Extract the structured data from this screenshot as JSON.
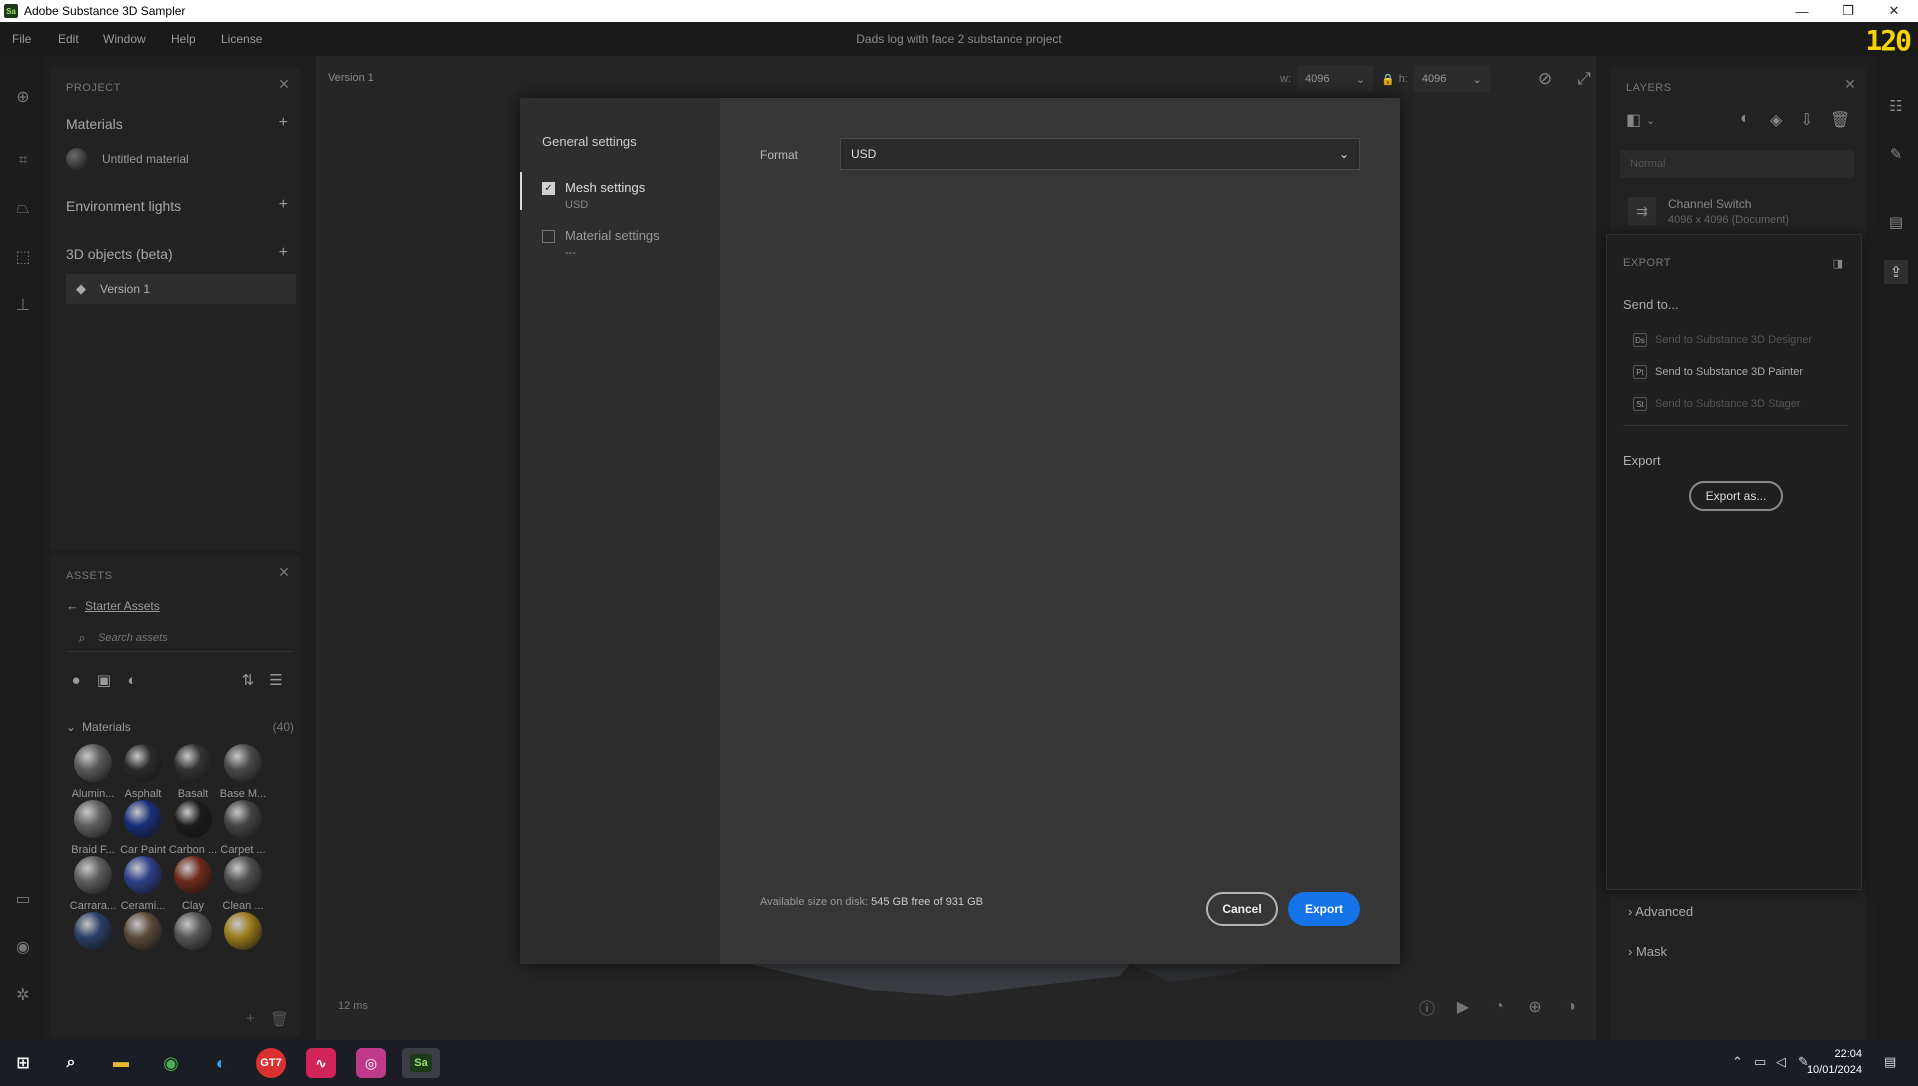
{
  "window": {
    "app_name": "Adobe Substance 3D Sampler",
    "logo": "Sa",
    "minimize": "—",
    "maximize": "❐",
    "close": "✕"
  },
  "menu": [
    "File",
    "Edit",
    "Window",
    "Help",
    "License"
  ],
  "document_title": "Dads log with face 2 substance project",
  "fps_overlay": "120",
  "project": {
    "header": "PROJECT",
    "materials_title": "Materials",
    "material_item": "Untitled material",
    "env_title": "Environment lights",
    "objects_title": "3D objects (beta)",
    "object_item": "Version 1"
  },
  "assets": {
    "header": "ASSETS",
    "breadcrumb": "Starter Assets",
    "search_placeholder": "Search assets",
    "materials_label": "Materials",
    "materials_count": "(40)",
    "swatches": [
      {
        "label": "Alumin...",
        "color": "#5a5a5a"
      },
      {
        "label": "Asphalt",
        "color": "#2b2b2b"
      },
      {
        "label": "Basalt",
        "color": "#333333"
      },
      {
        "label": "Base M...",
        "color": "#4a4a4a"
      },
      {
        "label": "Braid F...",
        "color": "#606060"
      },
      {
        "label": "Car Paint",
        "color": "#1a2f7a"
      },
      {
        "label": "Carbon ...",
        "color": "#1c1c1c"
      },
      {
        "label": "Carpet ...",
        "color": "#454545"
      },
      {
        "label": "Carrara...",
        "color": "#5c5c5c"
      },
      {
        "label": "Cerami...",
        "color": "#2e3f8a"
      },
      {
        "label": "Clay",
        "color": "#6e2a1a"
      },
      {
        "label": "Clean ...",
        "color": "#4e4e4e"
      },
      {
        "label": "",
        "color": "#2a3f66"
      },
      {
        "label": "",
        "color": "#5a4a3a"
      },
      {
        "label": "",
        "color": "#555555"
      },
      {
        "label": "",
        "color": "#9a7a1a"
      }
    ]
  },
  "viewport": {
    "title": "Version 1",
    "w_label": "w:",
    "w_value": "4096",
    "h_label": "h:",
    "h_value": "4096",
    "render_time": "12 ms"
  },
  "layers": {
    "header": "LAYERS",
    "blend_mode": "Normal",
    "layer_name": "Channel Switch",
    "layer_sub": "4096 x 4096 (Document)",
    "advanced": "Advanced",
    "mask": "Mask"
  },
  "export_panel": {
    "header": "EXPORT",
    "send_to": "Send to...",
    "send_items": [
      {
        "label": "Send to Substance 3D Designer",
        "badge": "Ds",
        "enabled": false
      },
      {
        "label": "Send to Substance 3D Painter",
        "badge": "Pt",
        "enabled": true
      },
      {
        "label": "Send to Substance 3D Stager",
        "badge": "St",
        "enabled": false
      }
    ],
    "export_title": "Export",
    "export_as": "Export as..."
  },
  "dialog": {
    "general_settings": "General settings",
    "mesh_settings": "Mesh settings",
    "mesh_sub": "USD",
    "mesh_checked": true,
    "material_settings": "Material settings",
    "material_sub": "---",
    "material_checked": false,
    "format_label": "Format",
    "format_value": "USD",
    "disk_label": "Available size on disk:",
    "disk_value": "545 GB free of 931 GB",
    "cancel": "Cancel",
    "export": "Export"
  },
  "taskbar": {
    "time": "22:04",
    "date": "10/01/2024",
    "app_badge_gt": "GT7",
    "app_badge_sa": "Sa"
  },
  "colors": {
    "accent": "#1473e6",
    "fps": "#f5d400"
  }
}
